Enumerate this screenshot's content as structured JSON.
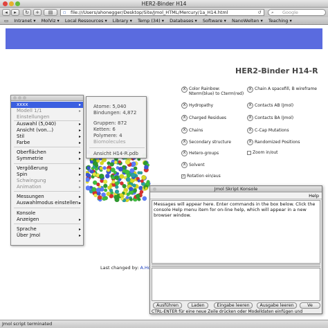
{
  "window": {
    "title": "HER2-Binder H14"
  },
  "toolbar": {
    "url": "file:///Users/ahonegger/Desktop/Site/Jmol_HTML/Mercury/1a_H14.html",
    "search_placeholder": "Google",
    "back_icon": "back-arrow-icon",
    "forward_icon": "forward-arrow-icon"
  },
  "bookmarks": [
    "Intranet ▾",
    "MolViz ▾",
    "Local Ressources ▾",
    "Library ▾",
    "Temp (34) ▾",
    "Databases ▾",
    "Software ▾",
    "NanoWelten ▾",
    "Teaching ▾"
  ],
  "page": {
    "title": "HER2-Binder H14-R",
    "accent_color": "#5a6bdf",
    "changed_label": "Last changed by:",
    "changed_link": "A.Hone"
  },
  "options": {
    "left": [
      "Color Rainbow: Nterm(blue) to Cterm(red)",
      "Hydropathy",
      "Charged Residues",
      "Chains",
      "Secondary structure",
      "Hetero-groups",
      "Solvent",
      "Rotation ein/aus"
    ],
    "right": [
      "Chain A spacefill, B wireframe",
      "Contacts AB (Jmol)",
      "Contacts BA (Jmol)",
      "C-Cap Mutations",
      "Randomized Positions",
      "Zoom in/out"
    ],
    "x_label": "X",
    "rotation_checked": "✓"
  },
  "menu": {
    "items": [
      {
        "label": "xxxx",
        "state": "selected",
        "arrow": "▸"
      },
      {
        "label": "Modell 1/1",
        "state": "disabled",
        "arrow": "▸"
      },
      {
        "label": "Einstellungen",
        "state": "disabled",
        "arrow": ""
      },
      {
        "label": "Auswahl (5,040)",
        "state": "normal",
        "arrow": "▸"
      },
      {
        "label": "Ansicht (von...)",
        "state": "normal",
        "arrow": "▸"
      },
      {
        "label": "Stil",
        "state": "normal",
        "arrow": "▸"
      },
      {
        "label": "Farbe",
        "state": "normal",
        "arrow": "▸"
      },
      {
        "label": "Oberflächen",
        "state": "normal",
        "arrow": "▸"
      },
      {
        "label": "Symmetrie",
        "state": "normal",
        "arrow": "▸"
      },
      {
        "label": "Vergößerung",
        "state": "normal",
        "arrow": "▸"
      },
      {
        "label": "Spin",
        "state": "normal",
        "arrow": "▸"
      },
      {
        "label": "Schwingung",
        "state": "disabled",
        "arrow": "▸"
      },
      {
        "label": "Animation",
        "state": "disabled",
        "arrow": "▸"
      },
      {
        "label": "Messungen",
        "state": "normal",
        "arrow": "▸"
      },
      {
        "label": "Auswahlmodus einstellen",
        "state": "normal",
        "arrow": "▸"
      },
      {
        "label": "Konsole",
        "state": "normal",
        "arrow": ""
      },
      {
        "label": "Anzeigen",
        "state": "normal",
        "arrow": "▸"
      },
      {
        "label": "Sprache",
        "state": "normal",
        "arrow": "▸"
      },
      {
        "label": "Über Jmol",
        "state": "normal",
        "arrow": "▸"
      }
    ]
  },
  "submenu": {
    "items": [
      {
        "label": "Atome: 5,040",
        "state": "normal"
      },
      {
        "label": "Bindungen: 4,872",
        "state": "normal"
      },
      {
        "label": "Gruppen: 872",
        "state": "normal"
      },
      {
        "label": "Ketten: 6",
        "state": "normal"
      },
      {
        "label": "Polymere: 4",
        "state": "normal"
      },
      {
        "label": "Biomolecules",
        "state": "disabled"
      },
      {
        "label": "Ansicht H14-R.pdb",
        "state": "normal"
      }
    ]
  },
  "console": {
    "title": "Jmol Skript Konsole",
    "help_menu": "Help",
    "messages": "Messages will appear here. Enter commands in the box below. Click the console Help menu item for on-line help, which will appear in a new browser window.",
    "buttons": [
      "Ausführen",
      "Laden",
      "Eingabe leeren",
      "Ausgabe leeren",
      "Ve"
    ],
    "hint": "CTRL-ENTER für eine neue Zeile drücken oder Modelldaten einfügen und"
  },
  "status": {
    "text": "Jmol script terminated"
  }
}
